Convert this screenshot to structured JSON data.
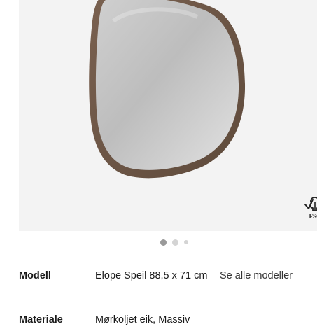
{
  "gallery": {
    "image_alt": "Elope Speil mirror",
    "badge": {
      "icon": "fsc-tree-icon",
      "text": "FSC"
    },
    "dots": {
      "count": 3,
      "active_index": 0
    }
  },
  "specs": [
    {
      "label": "Modell",
      "value": "Elope Speil 88,5 x 71 cm",
      "link": "Se alle modeller"
    },
    {
      "label": "Materiale",
      "value": "Mørkoljet eik, Massiv"
    }
  ],
  "colors": {
    "frame": "#6b5443",
    "gallery_bg": "#f3f3f3",
    "dot_active": "#9a9a9a",
    "dot_inactive": "#d4d4d4"
  }
}
